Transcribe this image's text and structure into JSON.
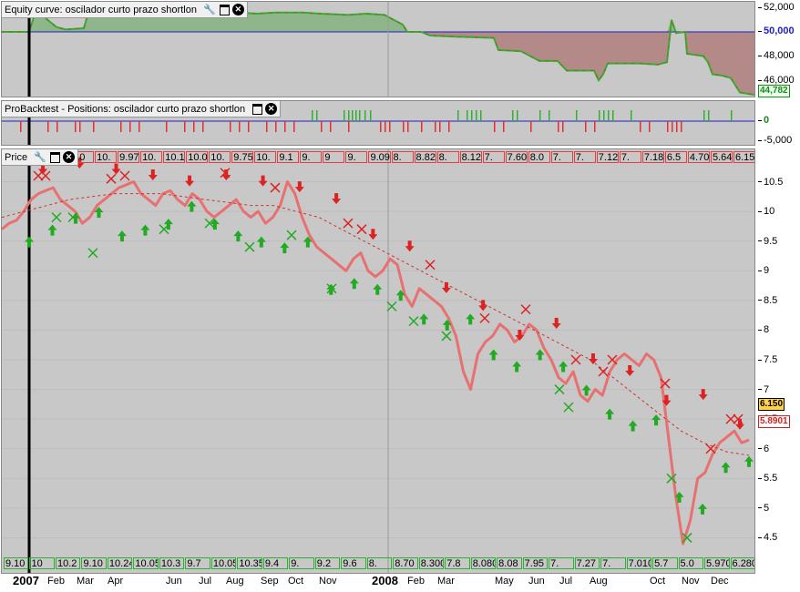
{
  "panels": {
    "equity": {
      "title": "Equity curve: oscilador curto prazo shortlon",
      "ticks": [
        "52,000",
        "50,000",
        "48,000",
        "46,000"
      ],
      "last_value": "44,782"
    },
    "positions": {
      "title": "ProBacktest - Positions: oscilador curto prazo shortlon",
      "ticks": [
        "0",
        "-5,000"
      ]
    },
    "price": {
      "title": "Price",
      "ticks": [
        "10.5",
        "10",
        "9.5",
        "9",
        "8.5",
        "8",
        "7.5",
        "7",
        "6.5",
        "6",
        "5.5",
        "5",
        "4.5"
      ],
      "last_price": "6.150",
      "ma_value": "5.8901"
    }
  },
  "top_strip": [
    "9.",
    "10",
    "10",
    "10",
    "10.",
    "9.970 *256",
    "10.",
    "10.1",
    "10.00",
    "10.",
    "9.75",
    "10.",
    "9.1",
    "9.",
    "9",
    "9.",
    "9.090",
    "8.",
    "8.820",
    "8.",
    "8.120 *32",
    "7.",
    "7.605",
    "8.0",
    "7.",
    "7.",
    "7.125",
    "7.",
    "7.180 *326",
    "6.5",
    "4.700",
    "5.64",
    "6.150 *36"
  ],
  "bottom_strip": [
    "9.10",
    "10",
    "10.2",
    "9.10",
    "10.24",
    "10.050 *2",
    "10.3",
    "9.7",
    "10.05",
    "10.35",
    "9.4",
    "9.",
    "9.2",
    "9.6",
    "8.",
    "8.70",
    "8.300",
    "7.8",
    "8.080",
    "8.08",
    "7.95",
    "7.",
    "7.27",
    "7.",
    "7.010 *3264",
    "5.7",
    "5.0",
    "5.970",
    "6.280 *36"
  ],
  "xaxis": [
    {
      "t": "2007",
      "year": true
    },
    {
      "t": "Feb"
    },
    {
      "t": "Mar"
    },
    {
      "t": "Apr"
    },
    {
      "t": "Jun"
    },
    {
      "t": "Jul"
    },
    {
      "t": "Aug"
    },
    {
      "t": "Sep"
    },
    {
      "t": "Oct"
    },
    {
      "t": "Nov"
    },
    {
      "t": "2008",
      "year": true
    },
    {
      "t": "Feb"
    },
    {
      "t": "Mar"
    },
    {
      "t": "May"
    },
    {
      "t": "Jun"
    },
    {
      "t": "Jul"
    },
    {
      "t": "Aug"
    },
    {
      "t": "Oct"
    },
    {
      "t": "Nov"
    },
    {
      "t": "Dec"
    }
  ],
  "colors": {
    "panel_bg": "#c8c8c8",
    "equity_up": "#8fb58a",
    "equity_down": "#b38a87",
    "curve_green": "#30b030",
    "curve_red": "#e03030",
    "price_line": "#e87070",
    "baseline": "#2020c0",
    "buy": "#22aa22",
    "sell": "#dd2222"
  },
  "chart_data": {
    "type": "line",
    "title": "",
    "xlabel": "",
    "ylabel": "",
    "ylim": [
      4.2,
      10.8
    ],
    "price_series": [
      9.7,
      9.8,
      9.85,
      10.0,
      10.2,
      10.3,
      10.35,
      10.4,
      10.2,
      10.1,
      10.0,
      9.8,
      9.9,
      10.1,
      10.2,
      10.3,
      10.4,
      10.45,
      10.5,
      10.3,
      10.2,
      10.1,
      10.3,
      10.35,
      10.2,
      10.1,
      10.3,
      10.2,
      10.0,
      9.9,
      10.0,
      10.1,
      10.2,
      10.0,
      9.9,
      10.0,
      9.8,
      9.9,
      10.1,
      10.5,
      10.3,
      9.9,
      9.6,
      9.4,
      9.3,
      9.2,
      9.1,
      9.0,
      9.2,
      9.3,
      9.0,
      8.9,
      9.0,
      9.2,
      9.1,
      8.6,
      8.4,
      8.7,
      8.6,
      8.5,
      8.4,
      8.2,
      7.9,
      7.3,
      7.0,
      7.6,
      7.8,
      7.9,
      8.1,
      8.0,
      7.8,
      7.9,
      8.1,
      8.0,
      7.7,
      7.5,
      7.2,
      7.1,
      7.3,
      6.9,
      6.8,
      7.0,
      6.9,
      7.3,
      7.5,
      7.6,
      7.5,
      7.4,
      7.6,
      7.5,
      7.2,
      6.2,
      5.2,
      4.4,
      4.8,
      5.5,
      5.6,
      5.9,
      6.1,
      6.2,
      6.3,
      6.1,
      6.15
    ],
    "ma_series": [
      9.9,
      10.0,
      10.1,
      10.2,
      10.25,
      10.3,
      10.3,
      10.3,
      10.25,
      10.2,
      10.15,
      10.1,
      10.1,
      10.0,
      9.9,
      9.7,
      9.5,
      9.3,
      9.1,
      8.9,
      8.7,
      8.5,
      8.3,
      8.1,
      7.9,
      7.7,
      7.5,
      7.2,
      6.9,
      6.6,
      6.3,
      6.1,
      5.95,
      5.89
    ],
    "buy_signals": [
      9.7,
      9.9,
      10.1,
      10.2,
      9.8,
      9.9,
      10.0,
      10.3,
      10.0,
      9.8,
      9.7,
      9.6,
      9.7,
      8.9,
      9.0,
      8.9,
      8.8,
      8.4,
      8.3,
      8.4,
      7.8,
      7.6,
      7.8,
      7.6,
      7.2,
      6.8,
      6.6,
      6.7,
      5.4,
      5.2,
      5.9,
      6.0
    ],
    "sell_signals": [
      10.5,
      10.6,
      10.5,
      10.4,
      10.3,
      10.4,
      10.3,
      10.2,
      10.0,
      9.4,
      9.2,
      8.5,
      8.2,
      7.7,
      7.9,
      7.3,
      7.1,
      6.6,
      6.7,
      6.2
    ]
  }
}
